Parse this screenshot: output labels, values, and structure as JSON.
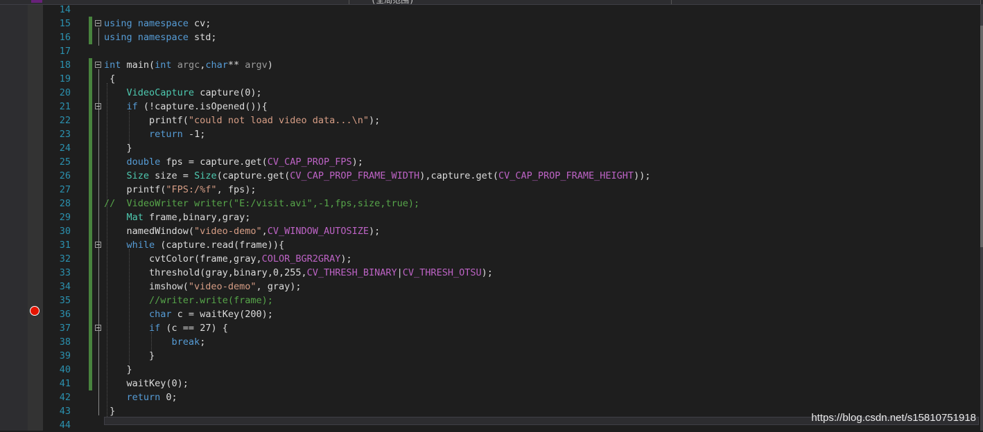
{
  "header": {
    "tab_text": "(全局范围)"
  },
  "breakpoint": {
    "line": 36
  },
  "lines": [
    {
      "num": "14",
      "html": ""
    },
    {
      "num": "15",
      "html": "<span class='kw'>using namespace</span> cv;"
    },
    {
      "num": "16",
      "html": "<span class='kw'>using namespace</span> std;"
    },
    {
      "num": "17",
      "html": ""
    },
    {
      "num": "18",
      "html": "<span class='kw'>int</span> main(<span class='kw'>int</span> <span class='pr'>argc</span>,<span class='kw'>char</span>** <span class='pr'>argv</span>)"
    },
    {
      "num": "19",
      "html": " {"
    },
    {
      "num": "20",
      "html": "    <span class='ty'>VideoCapture</span> capture(0);"
    },
    {
      "num": "21",
      "html": "    <span class='kw'>if</span> (!capture.isOpened()){"
    },
    {
      "num": "22",
      "html": "        printf(<span class='str'>\"could not load video data...\\n\"</span>);"
    },
    {
      "num": "23",
      "html": "        <span class='kw'>return</span> -1;"
    },
    {
      "num": "24",
      "html": "    }"
    },
    {
      "num": "25",
      "html": "    <span class='kw'>double</span> fps = capture.get(<span class='mac'>CV_CAP_PROP_FPS</span>);"
    },
    {
      "num": "26",
      "html": "    <span class='ty'>Size</span> size = <span class='ty'>Size</span>(capture.get(<span class='mac'>CV_CAP_PROP_FRAME_WIDTH</span>),capture.get(<span class='mac'>CV_CAP_PROP_FRAME_HEIGHT</span>));"
    },
    {
      "num": "27",
      "html": "    printf(<span class='str'>\"FPS:/%f\"</span>, fps);"
    },
    {
      "num": "28",
      "html": "<span class='cm'>//  VideoWriter writer(\"E:/visit.avi\",-1,fps,size,true);</span>"
    },
    {
      "num": "29",
      "html": "    <span class='ty'>Mat</span> frame,binary,gray;"
    },
    {
      "num": "30",
      "html": "    namedWindow(<span class='str'>\"video-demo\"</span>,<span class='mac'>CV_WINDOW_AUTOSIZE</span>);"
    },
    {
      "num": "31",
      "html": "    <span class='kw'>while</span> (capture.read(frame)){"
    },
    {
      "num": "32",
      "html": "        cvtColor(frame,gray,<span class='mac'>COLOR_BGR2GRAY</span>);"
    },
    {
      "num": "33",
      "html": "        threshold(gray,binary,0,255,<span class='mac'>CV_THRESH_BINARY</span>|<span class='mac'>CV_THRESH_OTSU</span>);"
    },
    {
      "num": "34",
      "html": "        imshow(<span class='str'>\"video-demo\"</span>, gray);"
    },
    {
      "num": "35",
      "html": "        <span class='cm'>//writer.write(frame);</span>"
    },
    {
      "num": "36",
      "html": "        <span class='kw'>char</span> c = waitKey(200);"
    },
    {
      "num": "37",
      "html": "        <span class='kw'>if</span> (c == 27) {"
    },
    {
      "num": "38",
      "html": "            <span class='kw'>break</span>;"
    },
    {
      "num": "39",
      "html": "        }"
    },
    {
      "num": "40",
      "html": "    }"
    },
    {
      "num": "41",
      "html": "    waitKey(0);"
    },
    {
      "num": "42",
      "html": "    <span class='kw'>return</span> 0;"
    },
    {
      "num": "43",
      "html": " }"
    },
    {
      "num": "44",
      "html": ""
    }
  ],
  "watermark": "https://blog.csdn.net/s15810751918"
}
